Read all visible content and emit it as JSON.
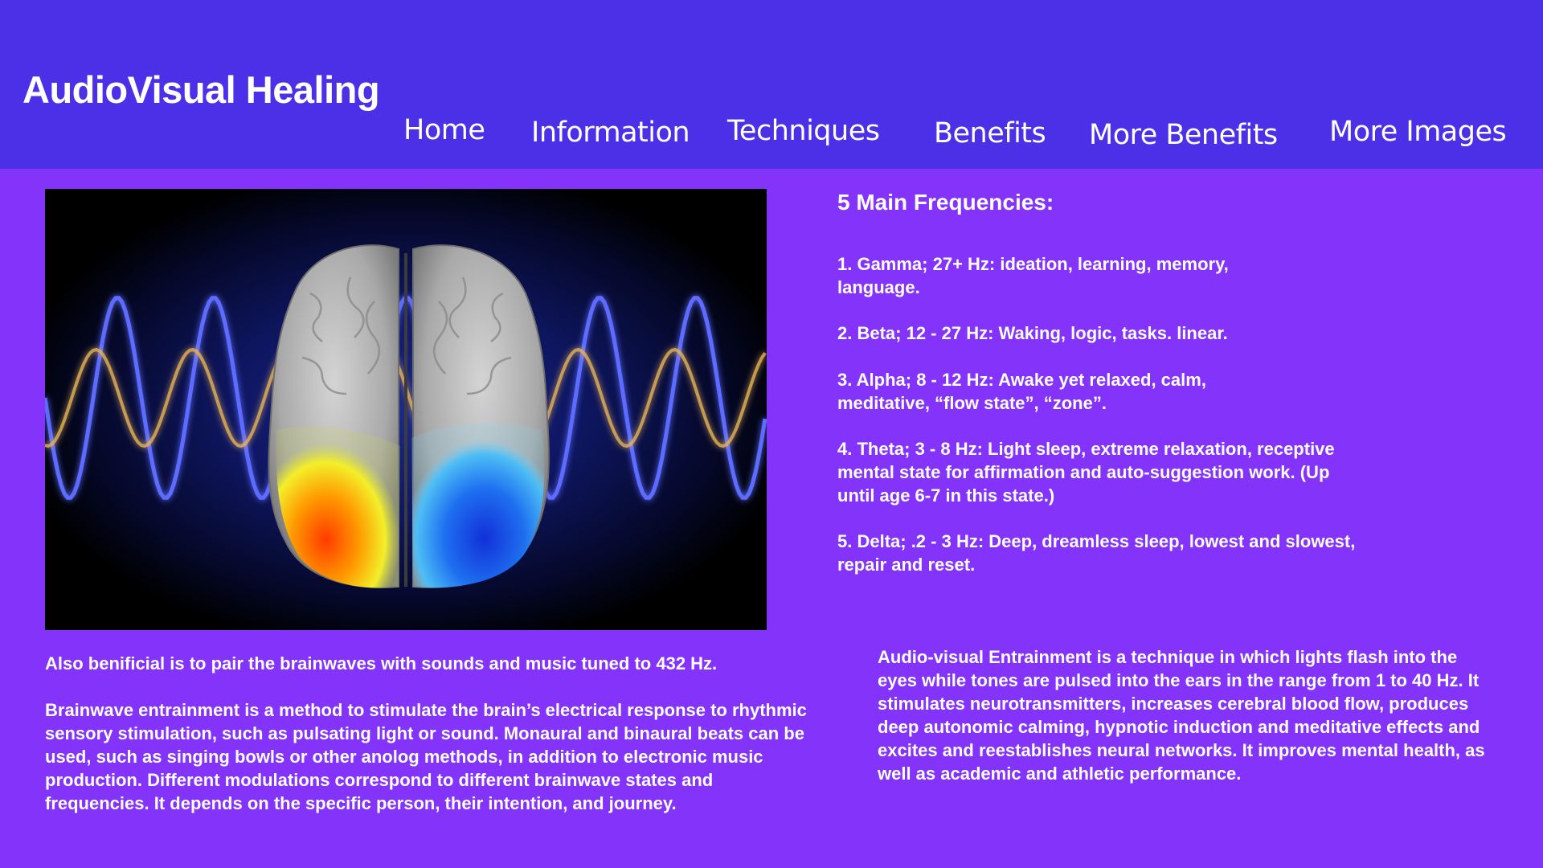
{
  "header": {
    "site_title": "AudioVisual Healing",
    "nav": {
      "home": "Home",
      "information": "Information",
      "techniques": "Techniques",
      "benefits": "Benefits",
      "more_benefits": "More Benefits",
      "more_images": "More Images"
    }
  },
  "colors": {
    "header_bg": "#4c30e8",
    "page_bg": "#8433fb",
    "text": "#ffffff"
  },
  "hero_image": {
    "subject": "brain-with-sound-waves-image"
  },
  "frequencies": {
    "heading": "5 Main Frequencies:",
    "items": [
      "1. Gamma; 27+ Hz: ideation, learning, memory, language.",
      "2. Beta; 12 - 27 Hz: Waking, logic, tasks. linear.",
      "3. Alpha; 8 - 12 Hz: Awake yet relaxed, calm, meditative, “flow state”, “zone”.",
      "4. Theta; 3 - 8 Hz: Light sleep, extreme relaxation, receptive mental state for affirmation and auto-suggestion work. (Up until age 6-7 in this state.)",
      "5. Delta; .2 - 3 Hz: Deep, dreamless sleep, lowest and slowest, repair and reset."
    ]
  },
  "body": {
    "note_432": "Also benificial is to pair the brainwaves with sounds and music tuned to 432 Hz.",
    "entrainment": "Brainwave entrainment is a method to stimulate the brain’s electrical response to rhythmic sensory stimulation, such as pulsating light or sound. Monaural and binaural beats can be used, such as singing bowls or other anolog methods, in addition to electronic music production. Different modulations correspond to different brainwave states and frequencies. It depends on the specific person, their intention, and journey.",
    "avs": "Audio-visual Entrainment is a technique in which lights flash into the eyes while tones are pulsed into the ears in the range from 1 to 40 Hz. It stimulates neurotransmitters, increases cerebral blood flow, produces deep autonomic calming, hypnotic induction and meditative effects and excites and reestablishes neural networks. It improves mental health, as well as academic and athletic performance."
  }
}
